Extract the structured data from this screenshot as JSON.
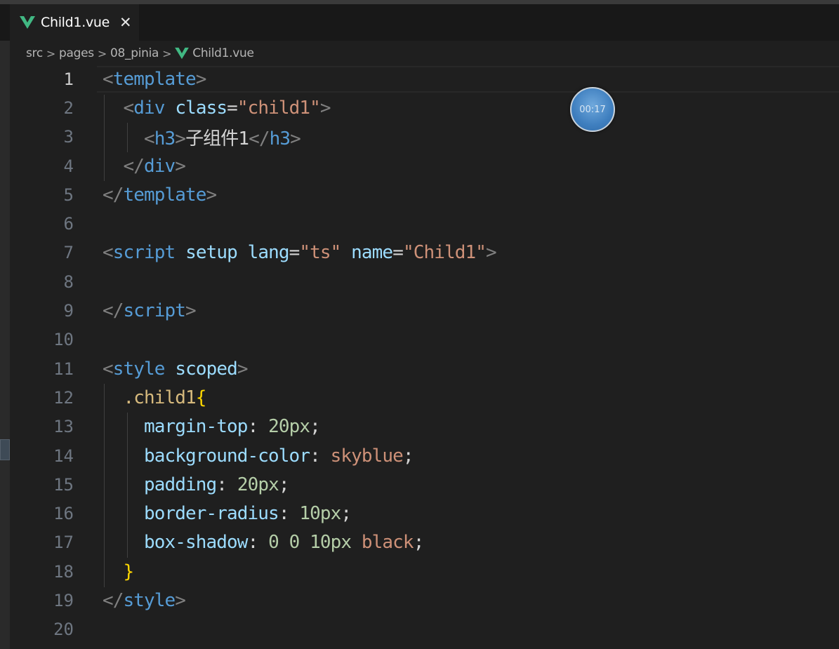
{
  "tab": {
    "label": "Child1.vue",
    "close": "✕",
    "icon": "vue-icon"
  },
  "breadcrumb": {
    "items": [
      "src",
      "pages",
      "08_pinia",
      "Child1.vue"
    ],
    "separator": ">"
  },
  "timer": {
    "label": "00:17"
  },
  "editor": {
    "active_line": 1,
    "line_numbers": [
      "1",
      "2",
      "3",
      "4",
      "5",
      "6",
      "7",
      "8",
      "9",
      "10",
      "11",
      "12",
      "13",
      "14",
      "15",
      "16",
      "17",
      "18",
      "19",
      "20"
    ],
    "lines": [
      [
        [
          "t-bracket",
          "<"
        ],
        [
          "t-tag",
          "template"
        ],
        [
          "t-bracket",
          ">"
        ]
      ],
      [
        [
          "t-plain",
          "  "
        ],
        [
          "t-bracket",
          "<"
        ],
        [
          "t-tag",
          "div"
        ],
        [
          "t-plain",
          " "
        ],
        [
          "t-attr",
          "class"
        ],
        [
          "t-plain",
          "="
        ],
        [
          "t-str",
          "\"child1\""
        ],
        [
          "t-bracket",
          ">"
        ]
      ],
      [
        [
          "t-plain",
          "    "
        ],
        [
          "t-bracket",
          "<"
        ],
        [
          "t-tag",
          "h3"
        ],
        [
          "t-bracket",
          ">"
        ],
        [
          "t-plain",
          "子组件1"
        ],
        [
          "t-bracket",
          "</"
        ],
        [
          "t-tag",
          "h3"
        ],
        [
          "t-bracket",
          ">"
        ]
      ],
      [
        [
          "t-plain",
          "  "
        ],
        [
          "t-bracket",
          "</"
        ],
        [
          "t-tag",
          "div"
        ],
        [
          "t-bracket",
          ">"
        ]
      ],
      [
        [
          "t-bracket",
          "</"
        ],
        [
          "t-tag",
          "template"
        ],
        [
          "t-bracket",
          ">"
        ]
      ],
      [],
      [
        [
          "t-bracket",
          "<"
        ],
        [
          "t-tag",
          "script"
        ],
        [
          "t-plain",
          " "
        ],
        [
          "t-attr",
          "setup"
        ],
        [
          "t-plain",
          " "
        ],
        [
          "t-attr",
          "lang"
        ],
        [
          "t-plain",
          "="
        ],
        [
          "t-str",
          "\"ts\""
        ],
        [
          "t-plain",
          " "
        ],
        [
          "t-attr",
          "name"
        ],
        [
          "t-plain",
          "="
        ],
        [
          "t-str",
          "\"Child1\""
        ],
        [
          "t-bracket",
          ">"
        ]
      ],
      [],
      [
        [
          "t-bracket",
          "</"
        ],
        [
          "t-tag",
          "script"
        ],
        [
          "t-bracket",
          ">"
        ]
      ],
      [],
      [
        [
          "t-bracket",
          "<"
        ],
        [
          "t-tag",
          "style"
        ],
        [
          "t-plain",
          " "
        ],
        [
          "t-attr",
          "scoped"
        ],
        [
          "t-bracket",
          ">"
        ]
      ],
      [
        [
          "t-plain",
          "  "
        ],
        [
          "t-sel",
          ".child1"
        ],
        [
          "t-brace",
          "{"
        ]
      ],
      [
        [
          "t-plain",
          "    "
        ],
        [
          "t-prop",
          "margin-top"
        ],
        [
          "t-punct",
          ": "
        ],
        [
          "t-num",
          "20px"
        ],
        [
          "t-punct",
          ";"
        ]
      ],
      [
        [
          "t-plain",
          "    "
        ],
        [
          "t-prop",
          "background-color"
        ],
        [
          "t-punct",
          ": "
        ],
        [
          "t-val",
          "skyblue"
        ],
        [
          "t-punct",
          ";"
        ]
      ],
      [
        [
          "t-plain",
          "    "
        ],
        [
          "t-prop",
          "padding"
        ],
        [
          "t-punct",
          ": "
        ],
        [
          "t-num",
          "20px"
        ],
        [
          "t-punct",
          ";"
        ]
      ],
      [
        [
          "t-plain",
          "    "
        ],
        [
          "t-prop",
          "border-radius"
        ],
        [
          "t-punct",
          ": "
        ],
        [
          "t-num",
          "10px"
        ],
        [
          "t-punct",
          ";"
        ]
      ],
      [
        [
          "t-plain",
          "    "
        ],
        [
          "t-prop",
          "box-shadow"
        ],
        [
          "t-punct",
          ": "
        ],
        [
          "t-num",
          "0"
        ],
        [
          "t-plain",
          " "
        ],
        [
          "t-num",
          "0"
        ],
        [
          "t-plain",
          " "
        ],
        [
          "t-num",
          "10px"
        ],
        [
          "t-plain",
          " "
        ],
        [
          "t-val",
          "black"
        ],
        [
          "t-punct",
          ";"
        ]
      ],
      [
        [
          "t-plain",
          "  "
        ],
        [
          "t-brace",
          "}"
        ]
      ],
      [
        [
          "t-bracket",
          "</"
        ],
        [
          "t-tag",
          "style"
        ],
        [
          "t-bracket",
          ">"
        ]
      ],
      []
    ]
  },
  "colors": {
    "background": "#1f1f1f",
    "tag": "#569cd6",
    "attribute": "#9cdcfe",
    "string": "#ce9178",
    "number": "#b5cea8",
    "selector": "#d7ba7d",
    "bracket": "#808080"
  }
}
